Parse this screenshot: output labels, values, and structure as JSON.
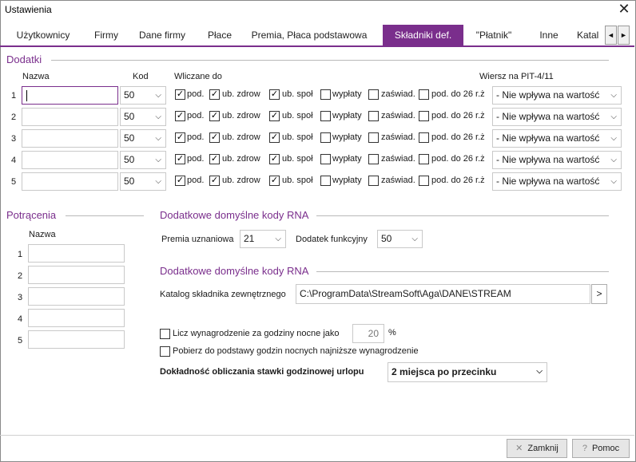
{
  "window": {
    "title": "Ustawienia",
    "close_label": "✕"
  },
  "tabs": [
    {
      "label": "Użytkownicy",
      "active": false
    },
    {
      "label": "Firmy",
      "active": false
    },
    {
      "label": "Dane firmy",
      "active": false
    },
    {
      "label": "Płace",
      "active": false
    },
    {
      "label": "Premia, Płaca podstawowa",
      "active": false
    },
    {
      "label": "Składniki def.",
      "active": true
    },
    {
      "label": "\"Płatnik\"",
      "active": false
    },
    {
      "label": "Inne",
      "active": false
    },
    {
      "label": "Katal",
      "active": false
    }
  ],
  "tab_scroll": {
    "left": "◄",
    "right": "►"
  },
  "dodatki": {
    "title": "Dodatki",
    "col_nazwa": "Nazwa",
    "col_kod": "Kod",
    "col_wliczane": "Wliczane do",
    "col_wiersz": "Wiersz na PIT-4/11",
    "rows": [
      {
        "num": "1",
        "kod": "50",
        "pod": true,
        "zdrow": true,
        "spol": true,
        "wyplaty": false,
        "zaswiad": false,
        "pod26": false,
        "pit": "- Nie wpływa na wartość"
      },
      {
        "num": "2",
        "kod": "50",
        "pod": true,
        "zdrow": true,
        "spol": true,
        "wyplaty": false,
        "zaswiad": false,
        "pod26": false,
        "pit": "- Nie wpływa na wartość"
      },
      {
        "num": "3",
        "kod": "50",
        "pod": true,
        "zdrow": true,
        "spol": true,
        "wyplaty": false,
        "zaswiad": false,
        "pod26": false,
        "pit": "- Nie wpływa na wartość"
      },
      {
        "num": "4",
        "kod": "50",
        "pod": true,
        "zdrow": true,
        "spol": true,
        "wyplaty": false,
        "zaswiad": false,
        "pod26": false,
        "pit": "- Nie wpływa na wartość"
      },
      {
        "num": "5",
        "kod": "50",
        "pod": true,
        "zdrow": true,
        "spol": true,
        "wyplaty": false,
        "zaswiad": false,
        "pod26": false,
        "pit": "- Nie wpływa na wartość"
      }
    ],
    "cb_labels": {
      "pod": "pod.",
      "zdrow": "ub. zdrow",
      "spol": "ub. społ",
      "wyplaty": "wypłaty",
      "zaswiad": "zaświad.",
      "pod26": "pod. do 26 r.ż"
    }
  },
  "potracenia": {
    "title": "Potrącenia",
    "col_nazwa": "Nazwa",
    "rows": [
      "1",
      "2",
      "3",
      "4",
      "5"
    ]
  },
  "rna1": {
    "title": "Dodatkowe domyślne kody RNA",
    "premia_label": "Premia uznaniowa",
    "premia_value": "21",
    "dodatek_label": "Dodatek funkcyjny",
    "dodatek_value": "50"
  },
  "rna2": {
    "title": "Dodatkowe domyślne kody RNA",
    "katalog_label": "Katalog składnika zewnętrznego",
    "katalog_value": "C:\\ProgramData\\StreamSoft\\Aga\\DANE\\STREAM",
    "browse_label": ">"
  },
  "options": {
    "nocne_label": "Licz wynagrodzenie za godziny nocne jako",
    "nocne_value": "20",
    "nocne_unit": "%",
    "pobierz_label": "Pobierz do podstawy godzin nocnych najniższe wynagrodzenie",
    "dokladnosc_label": "Dokładność obliczania stawki godzinowej urlopu",
    "dokladnosc_value": "2 miejsca po przecinku"
  },
  "footer": {
    "close_label": "Zamknij",
    "help_label": "Pomoc"
  },
  "colors": {
    "accent": "#7a2e8c"
  }
}
